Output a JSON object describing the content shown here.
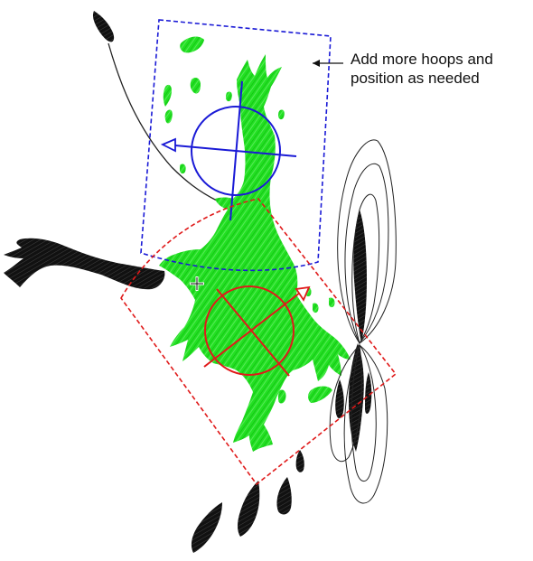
{
  "annotation": {
    "line1": "Add more hoops and",
    "line2": "position as needed"
  },
  "colors": {
    "design_fill": "#22e022",
    "design_stitch": "#0fb80f",
    "stitch_black": "#111111",
    "hoop_primary": "#1a1ad6",
    "hoop_secondary": "#e01a1a",
    "outline": "#222222"
  },
  "icons": {
    "cursor": "crosshair-cursor-icon",
    "pointer": "callout-arrow-icon"
  }
}
